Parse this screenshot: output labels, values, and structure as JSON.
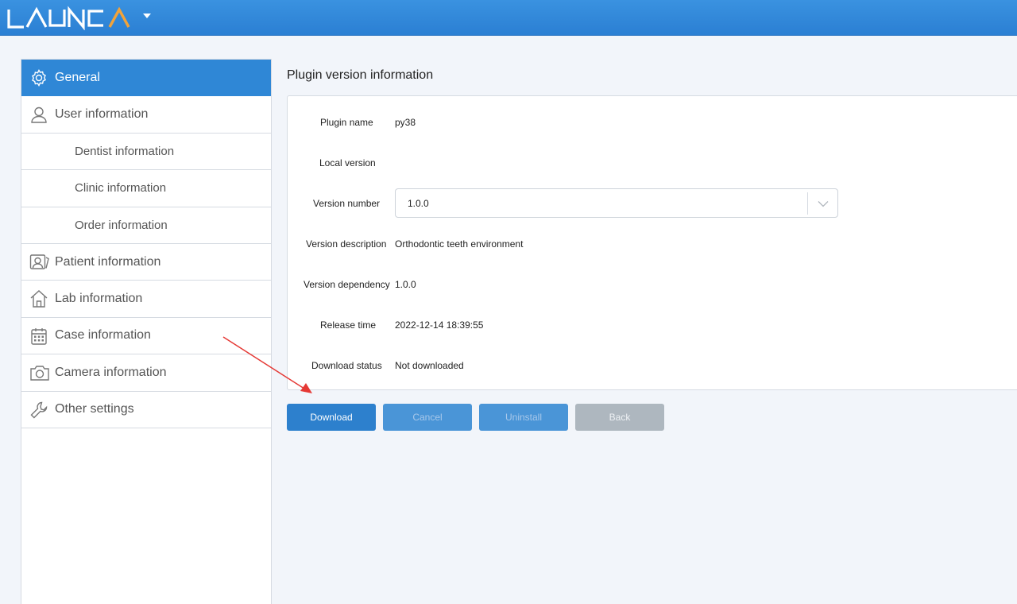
{
  "app": {
    "logo_text": "LAUNCA"
  },
  "sidebar": {
    "items": [
      {
        "label": "General",
        "icon": "gear-icon",
        "active": true
      },
      {
        "label": "User information",
        "icon": "user-icon"
      },
      {
        "label": "Dentist information",
        "sub": true
      },
      {
        "label": "Clinic information",
        "sub": true
      },
      {
        "label": "Order information",
        "sub": true
      },
      {
        "label": "Patient information",
        "icon": "patient-card-icon"
      },
      {
        "label": "Lab information",
        "icon": "home-icon"
      },
      {
        "label": "Case information",
        "icon": "calendar-icon"
      },
      {
        "label": "Camera information",
        "icon": "camera-icon"
      },
      {
        "label": "Other settings",
        "icon": "wrench-icon"
      }
    ]
  },
  "content": {
    "title": "Plugin version information",
    "fields": {
      "plugin_name": {
        "label": "Plugin name",
        "value": "py38"
      },
      "local_version": {
        "label": "Local version",
        "value": ""
      },
      "version_number": {
        "label": "Version number",
        "value": "1.0.0"
      },
      "version_description": {
        "label": "Version description",
        "value": "Orthodontic teeth environment"
      },
      "version_dependency": {
        "label": "Version dependency",
        "value": "1.0.0"
      },
      "release_time": {
        "label": "Release time",
        "value": "2022-12-14 18:39:55"
      },
      "download_status": {
        "label": "Download status",
        "value": "Not downloaded"
      }
    }
  },
  "buttons": {
    "download": "Download",
    "cancel": "Cancel",
    "uninstall": "Uninstall",
    "back": "Back"
  },
  "colors": {
    "accent": "#2f87d6",
    "annotation_arrow": "#e53935",
    "logo_accent": "#f2a33a"
  }
}
